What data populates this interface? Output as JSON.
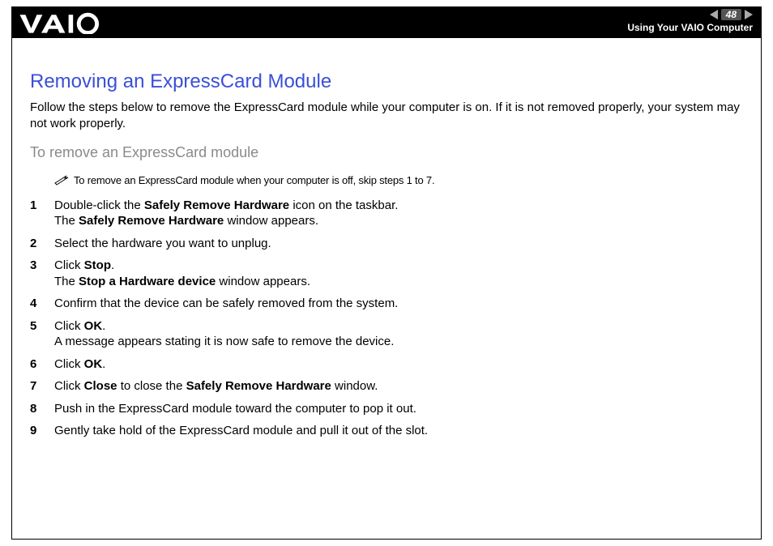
{
  "header": {
    "page_number": "48",
    "section": "Using Your VAIO Computer"
  },
  "title": "Removing an ExpressCard Module",
  "intro": "Follow the steps below to remove the ExpressCard module while your computer is on. If it is not removed properly, your system may not work properly.",
  "subheading": "To remove an ExpressCard module",
  "note": "To remove an ExpressCard module when your computer is off, skip steps 1 to 7.",
  "steps": [
    {
      "n": "1",
      "pre": "Double-click the ",
      "b1": "Safely Remove Hardware",
      "mid": " icon on the taskbar.",
      "line2_pre": "The ",
      "line2_b": "Safely Remove Hardware",
      "line2_post": " window appears."
    },
    {
      "n": "2",
      "pre": "Select the hardware you want to unplug."
    },
    {
      "n": "3",
      "pre": "Click ",
      "b1": "Stop",
      "mid": ".",
      "line2_pre": "The ",
      "line2_b": "Stop a Hardware device",
      "line2_post": " window appears."
    },
    {
      "n": "4",
      "pre": "Confirm that the device can be safely removed from the system."
    },
    {
      "n": "5",
      "pre": "Click ",
      "b1": "OK",
      "mid": ".",
      "line2_pre": "A message appears stating it is now safe to remove the device."
    },
    {
      "n": "6",
      "pre": "Click ",
      "b1": "OK",
      "mid": "."
    },
    {
      "n": "7",
      "pre": "Click ",
      "b1": "Close",
      "mid": " to close the ",
      "b2": "Safely Remove Hardware",
      "post": " window."
    },
    {
      "n": "8",
      "pre": "Push in the ExpressCard module toward the computer to pop it out."
    },
    {
      "n": "9",
      "pre": "Gently take hold of the ExpressCard module and pull it out of the slot."
    }
  ]
}
